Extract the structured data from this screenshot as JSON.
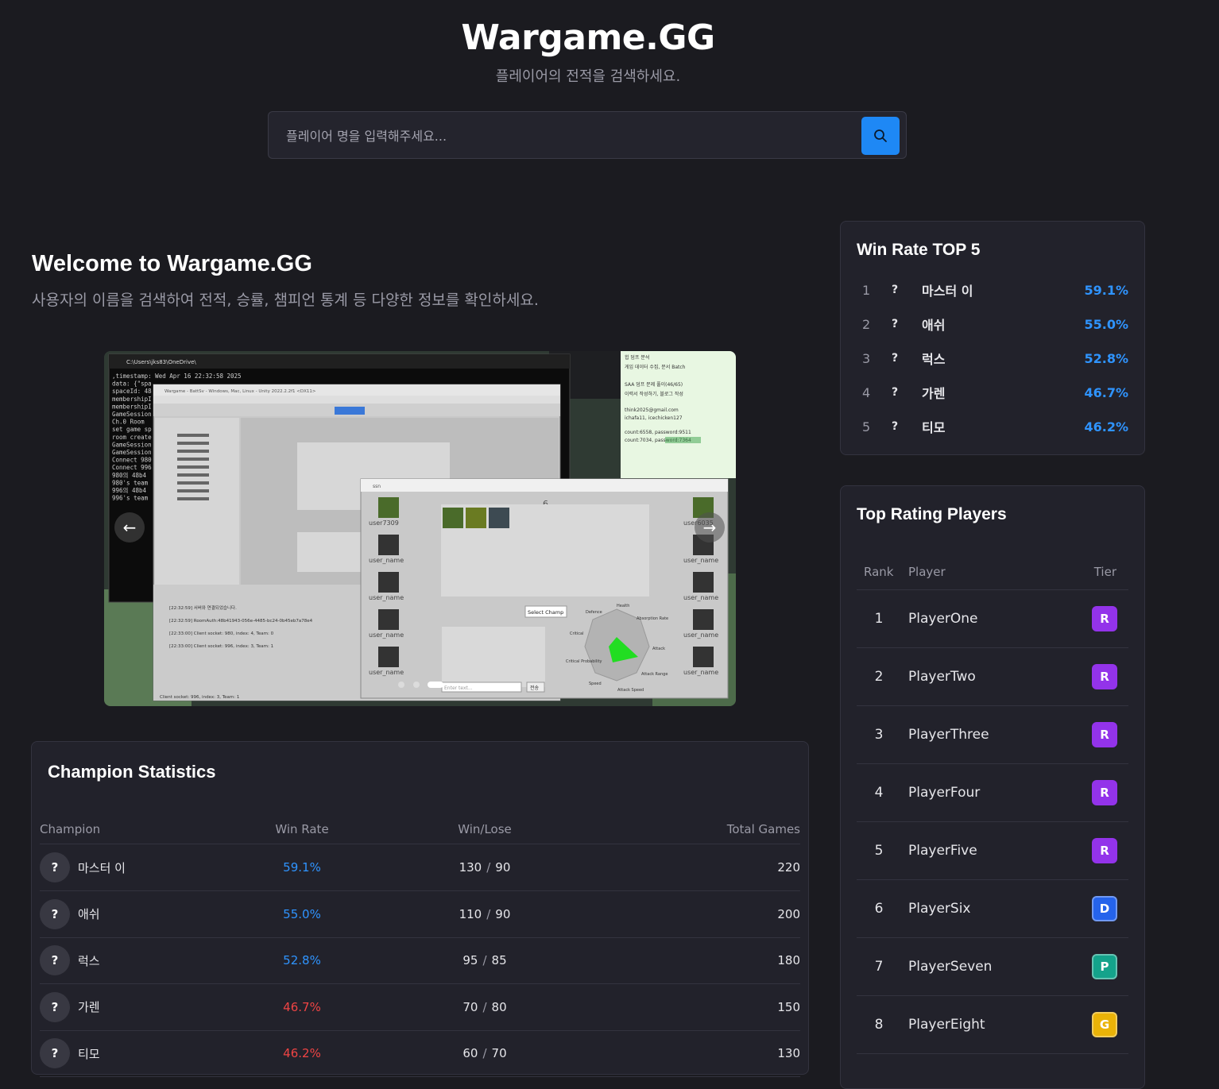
{
  "header": {
    "brand": "Wargame.GG",
    "subtitle": "플레이어의 전적을 검색하세요."
  },
  "search": {
    "placeholder": "플레이어 명을 입력해주세요...",
    "value": "",
    "button_icon": "search-icon"
  },
  "welcome": {
    "title": "Welcome to Wargame.GG",
    "description": "사용자의 이름을 검색하여 전적, 승률, 챔피언 통계 등 다양한 정보를 확인하세요."
  },
  "carousel": {
    "prev_icon": "chevron-left-icon",
    "next_icon": "chevron-right-icon",
    "slide": {
      "terminal_title": "C:\\Users\\jks83\\OneDrive\\",
      "terminal_lines": [
        ",timestamp: Wed Apr 16 22:32:58 2025",
        "data: {\"spa",
        "spaceId: 48",
        "membershipI",
        "membershipI",
        "GameSession",
        "Ch.0 Room",
        "set game sp",
        "room create",
        "GameSession",
        "GameSession",
        "Connect 980",
        "Connect 996",
        "980의 48b4",
        "980's team",
        "996의 48b4",
        "996's team"
      ],
      "unity_title": "Wargame - BattSv - Windows, Mac, Linux - Unity 2022.2.2f1 <DX11>",
      "game_title": "ssn",
      "players_left": [
        "user7309",
        "user_name",
        "user_name",
        "user_name",
        "user_name"
      ],
      "players_right": [
        "user6035",
        "user_name",
        "user_name",
        "user_name",
        "user_name"
      ],
      "round": "6",
      "select_champ": "Select Champ",
      "input_placeholder": "Enter text...",
      "send_button": "전송",
      "radar_labels": [
        "Health",
        "Absorption Rate",
        "Attack",
        "Attack Range",
        "Attack Speed",
        "Speed",
        "Critical Probability",
        "Critical",
        "Defence"
      ],
      "console_lines": [
        "[22:32:59] 서버와 연결되었습니다.",
        "[22:32:59] RoomAuth:48b41943-056e-4485-bc24-0b45eb7a78e4",
        "[22:33:00] Client socket: 980, index: 4, Team: 0",
        "[22:33:00] Client socket: 996, index: 3, Team: 1"
      ],
      "status_line": "Client socket: 996, index: 3, Team: 1",
      "notes_lines": [
        "힙 덤프 분석",
        "게임 데이터 수집, 문서 Batch",
        "SAA 덤프 문제 풀이(46/65)",
        "이력서 작성하기, 블로그 작성",
        "think2025@gmail.com",
        "ichafa11, icechicken127",
        "count:6558, password:9511",
        "count:7034, password:7364"
      ]
    }
  },
  "champion_stats": {
    "title": "Champion Statistics",
    "headers": {
      "champion": "Champion",
      "win_rate": "Win Rate",
      "win_lose": "Win/Lose",
      "total": "Total Games"
    },
    "rows": [
      {
        "icon": "?",
        "name": "마스터 이",
        "win_rate": "59.1%",
        "wins": "130",
        "sep": "/",
        "losses": "90",
        "total": "220",
        "rate_color": "#2f94ff"
      },
      {
        "icon": "?",
        "name": "애쉬",
        "win_rate": "55.0%",
        "wins": "110",
        "sep": "/",
        "losses": "90",
        "total": "200",
        "rate_color": "#2f94ff"
      },
      {
        "icon": "?",
        "name": "럭스",
        "win_rate": "52.8%",
        "wins": "95",
        "sep": "/",
        "losses": "85",
        "total": "180",
        "rate_color": "#2f94ff"
      },
      {
        "icon": "?",
        "name": "가렌",
        "win_rate": "46.7%",
        "wins": "70",
        "sep": "/",
        "losses": "80",
        "total": "150",
        "rate_color": "#ef4444"
      },
      {
        "icon": "?",
        "name": "티모",
        "win_rate": "46.2%",
        "wins": "60",
        "sep": "/",
        "losses": "70",
        "total": "130",
        "rate_color": "#ef4444"
      }
    ]
  },
  "win_rate_top5": {
    "title": "Win Rate TOP 5",
    "rows": [
      {
        "rank": "1",
        "icon": "?",
        "name": "마스터 이",
        "rate": "59.1%"
      },
      {
        "rank": "2",
        "icon": "?",
        "name": "애쉬",
        "rate": "55.0%"
      },
      {
        "rank": "3",
        "icon": "?",
        "name": "럭스",
        "rate": "52.8%"
      },
      {
        "rank": "4",
        "icon": "?",
        "name": "가렌",
        "rate": "46.7%"
      },
      {
        "rank": "5",
        "icon": "?",
        "name": "티모",
        "rate": "46.2%"
      }
    ]
  },
  "top_rating": {
    "title": "Top Rating Players",
    "headers": {
      "rank": "Rank",
      "player": "Player",
      "tier": "Tier"
    },
    "rows": [
      {
        "rank": "1",
        "player": "PlayerOne",
        "tier": "R",
        "tier_color": "#9333ea"
      },
      {
        "rank": "2",
        "player": "PlayerTwo",
        "tier": "R",
        "tier_color": "#9333ea"
      },
      {
        "rank": "3",
        "player": "PlayerThree",
        "tier": "R",
        "tier_color": "#9333ea"
      },
      {
        "rank": "4",
        "player": "PlayerFour",
        "tier": "R",
        "tier_color": "#9333ea"
      },
      {
        "rank": "5",
        "player": "PlayerFive",
        "tier": "R",
        "tier_color": "#9333ea"
      },
      {
        "rank": "6",
        "player": "PlayerSix",
        "tier": "D",
        "tier_color": "#2563eb"
      },
      {
        "rank": "7",
        "player": "PlayerSeven",
        "tier": "P",
        "tier_color": "#14a38b"
      },
      {
        "rank": "8",
        "player": "PlayerEight",
        "tier": "G",
        "tier_color": "#eab308"
      }
    ]
  }
}
